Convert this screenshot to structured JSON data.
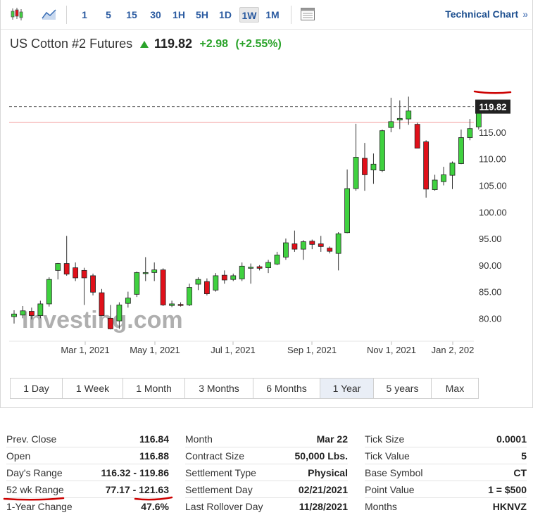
{
  "toolbar": {
    "timeframes": [
      "1",
      "5",
      "15",
      "30",
      "1H",
      "5H",
      "1D",
      "1W",
      "1M"
    ],
    "active_timeframe": "1W",
    "technical_link": "Technical Chart",
    "technical_link_arrow": "»",
    "icons": [
      "candlestick-chart-icon",
      "area-chart-icon",
      "calendar-table-icon"
    ]
  },
  "instrument": {
    "name": "US Cotton #2 Futures",
    "price": "119.82",
    "change": "+2.98",
    "change_pct": "(+2.55%)",
    "direction": "up",
    "up_color": "#2aa32a"
  },
  "chart_data": {
    "type": "candlestick",
    "ylim": [
      77,
      124
    ],
    "y_ticks": [
      "80.00",
      "85.00",
      "90.00",
      "95.00",
      "100.00",
      "105.00",
      "110.00",
      "115.00"
    ],
    "x_ticks": [
      "Mar 1, 2021",
      "May 1, 2021",
      "Jul 1, 2021",
      "Sep 1, 2021",
      "Nov 1, 2021",
      "Jan 2, 202"
    ],
    "current_price_label": "119.82",
    "current_price": 119.82,
    "reference_line": 116.84,
    "up_color": "#3fd13f",
    "down_color": "#e0101a",
    "watermark": "Investing.com",
    "candles": [
      {
        "o": 80.3,
        "h": 81.5,
        "l": 79.0,
        "c": 80.8
      },
      {
        "o": 80.6,
        "h": 82.3,
        "l": 80.0,
        "c": 81.4
      },
      {
        "o": 81.3,
        "h": 82.0,
        "l": 79.8,
        "c": 80.5
      },
      {
        "o": 80.5,
        "h": 83.3,
        "l": 80.0,
        "c": 82.7
      },
      {
        "o": 82.7,
        "h": 87.7,
        "l": 82.2,
        "c": 87.3
      },
      {
        "o": 89.0,
        "h": 90.4,
        "l": 87.3,
        "c": 90.3
      },
      {
        "o": 90.3,
        "h": 95.5,
        "l": 88.0,
        "c": 88.3
      },
      {
        "o": 89.5,
        "h": 90.5,
        "l": 87.0,
        "c": 87.6
      },
      {
        "o": 89.0,
        "h": 89.5,
        "l": 82.5,
        "c": 87.6
      },
      {
        "o": 88.0,
        "h": 88.4,
        "l": 84.3,
        "c": 84.9
      },
      {
        "o": 84.8,
        "h": 85.5,
        "l": 80.7,
        "c": 80.5
      },
      {
        "o": 80.0,
        "h": 82.5,
        "l": 77.9,
        "c": 78.0
      },
      {
        "o": 79.5,
        "h": 83.0,
        "l": 78.0,
        "c": 82.5
      },
      {
        "o": 82.8,
        "h": 85.0,
        "l": 82.0,
        "c": 83.8
      },
      {
        "o": 84.5,
        "h": 88.8,
        "l": 84.0,
        "c": 88.6
      },
      {
        "o": 88.5,
        "h": 91.5,
        "l": 87.0,
        "c": 88.6
      },
      {
        "o": 88.6,
        "h": 90.5,
        "l": 87.0,
        "c": 89.1
      },
      {
        "o": 89.1,
        "h": 89.4,
        "l": 82.3,
        "c": 82.5
      },
      {
        "o": 82.4,
        "h": 83.3,
        "l": 82.1,
        "c": 82.7
      },
      {
        "o": 82.6,
        "h": 83.0,
        "l": 82.2,
        "c": 82.4
      },
      {
        "o": 82.5,
        "h": 86.5,
        "l": 82.3,
        "c": 85.8
      },
      {
        "o": 86.4,
        "h": 87.7,
        "l": 85.3,
        "c": 87.3
      },
      {
        "o": 86.9,
        "h": 87.5,
        "l": 84.3,
        "c": 84.6
      },
      {
        "o": 85.3,
        "h": 88.5,
        "l": 85.0,
        "c": 88.0
      },
      {
        "o": 88.1,
        "h": 89.0,
        "l": 86.5,
        "c": 87.2
      },
      {
        "o": 87.3,
        "h": 88.4,
        "l": 87.0,
        "c": 88.0
      },
      {
        "o": 87.4,
        "h": 90.5,
        "l": 87.0,
        "c": 89.8
      },
      {
        "o": 89.5,
        "h": 90.3,
        "l": 86.5,
        "c": 89.6
      },
      {
        "o": 89.7,
        "h": 90.0,
        "l": 89.0,
        "c": 89.4
      },
      {
        "o": 89.5,
        "h": 91.0,
        "l": 88.5,
        "c": 90.5
      },
      {
        "o": 90.2,
        "h": 92.5,
        "l": 90.0,
        "c": 91.9
      },
      {
        "o": 91.5,
        "h": 95.0,
        "l": 91.0,
        "c": 94.2
      },
      {
        "o": 94.0,
        "h": 96.5,
        "l": 92.5,
        "c": 93.0
      },
      {
        "o": 93.0,
        "h": 94.7,
        "l": 91.0,
        "c": 94.4
      },
      {
        "o": 94.5,
        "h": 94.8,
        "l": 93.0,
        "c": 93.9
      },
      {
        "o": 94.0,
        "h": 95.5,
        "l": 92.5,
        "c": 93.5
      },
      {
        "o": 93.2,
        "h": 93.5,
        "l": 92.2,
        "c": 92.6
      },
      {
        "o": 92.2,
        "h": 96.2,
        "l": 89.0,
        "c": 95.9
      },
      {
        "o": 96.1,
        "h": 108.0,
        "l": 96.0,
        "c": 104.4
      },
      {
        "o": 104.4,
        "h": 116.6,
        "l": 104.0,
        "c": 110.3
      },
      {
        "o": 110.1,
        "h": 113.0,
        "l": 104.0,
        "c": 107.0
      },
      {
        "o": 107.9,
        "h": 111.0,
        "l": 105.3,
        "c": 109.0
      },
      {
        "o": 107.8,
        "h": 115.5,
        "l": 107.5,
        "c": 115.3
      },
      {
        "o": 115.9,
        "h": 121.5,
        "l": 115.0,
        "c": 117.0
      },
      {
        "o": 117.3,
        "h": 121.0,
        "l": 115.6,
        "c": 117.6
      },
      {
        "o": 117.5,
        "h": 121.7,
        "l": 116.4,
        "c": 119.0
      },
      {
        "o": 116.5,
        "h": 116.8,
        "l": 112.0,
        "c": 112.0
      },
      {
        "o": 113.2,
        "h": 113.5,
        "l": 102.7,
        "c": 104.3
      },
      {
        "o": 104.2,
        "h": 107.0,
        "l": 104.0,
        "c": 106.0
      },
      {
        "o": 105.7,
        "h": 108.5,
        "l": 105.0,
        "c": 107.0
      },
      {
        "o": 106.9,
        "h": 109.5,
        "l": 104.3,
        "c": 109.2
      },
      {
        "o": 109.1,
        "h": 115.5,
        "l": 109.0,
        "c": 114.0
      },
      {
        "o": 114.0,
        "h": 117.5,
        "l": 113.5,
        "c": 115.7
      },
      {
        "o": 116.0,
        "h": 120.5,
        "l": 115.5,
        "c": 119.8
      }
    ]
  },
  "ranges": [
    "1 Day",
    "1 Week",
    "1 Month",
    "3 Months",
    "6 Months",
    "1 Year",
    "5 years",
    "Max"
  ],
  "active_range": "1 Year",
  "stats": {
    "col1": [
      {
        "label": "Prev. Close",
        "value": "116.84"
      },
      {
        "label": "Open",
        "value": "116.88"
      },
      {
        "label": "Day's Range",
        "value": "116.32 - 119.86"
      },
      {
        "label": "52 wk Range",
        "value": "77.17 - 121.63"
      },
      {
        "label": "1-Year Change",
        "value": "47.6%"
      }
    ],
    "col2": [
      {
        "label": "Month",
        "value": "Mar 22"
      },
      {
        "label": "Contract Size",
        "value": "50,000 Lbs."
      },
      {
        "label": "Settlement Type",
        "value": "Physical"
      },
      {
        "label": "Settlement Day",
        "value": "02/21/2021"
      },
      {
        "label": "Last Rollover Day",
        "value": "11/28/2021"
      }
    ],
    "col3": [
      {
        "label": "Tick Size",
        "value": "0.0001"
      },
      {
        "label": "Tick Value",
        "value": "5"
      },
      {
        "label": "Base Symbol",
        "value": "CT"
      },
      {
        "label": "Point Value",
        "value": "1 = $500"
      },
      {
        "label": "Months",
        "value": "HKNVZ"
      }
    ]
  },
  "annotation_color": "#cc0000"
}
